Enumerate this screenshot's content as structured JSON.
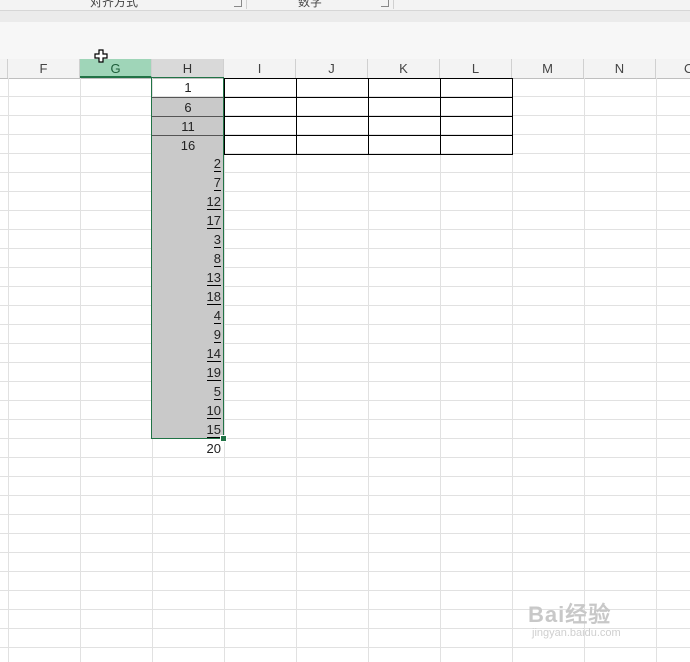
{
  "ribbon": {
    "group_align": "对齐方式",
    "group_number": "数字"
  },
  "columns": [
    "F",
    "G",
    "H",
    "I",
    "J",
    "K",
    "L",
    "M",
    "N",
    "O"
  ],
  "column_h": {
    "top_values": [
      "1",
      "6",
      "11",
      "16"
    ],
    "lower_values": [
      "2",
      "7",
      "12",
      "17",
      "3",
      "8",
      "13",
      "18",
      "4",
      "9",
      "14",
      "19",
      "5",
      "10",
      "15"
    ],
    "last_value": "20"
  },
  "watermark": {
    "brand": "Bai经验",
    "url": "jingyan.baidu.com"
  },
  "colors": {
    "selection": "#217346",
    "selected_header": "#9fd5b8",
    "gray_fill": "#c9c9c9"
  }
}
